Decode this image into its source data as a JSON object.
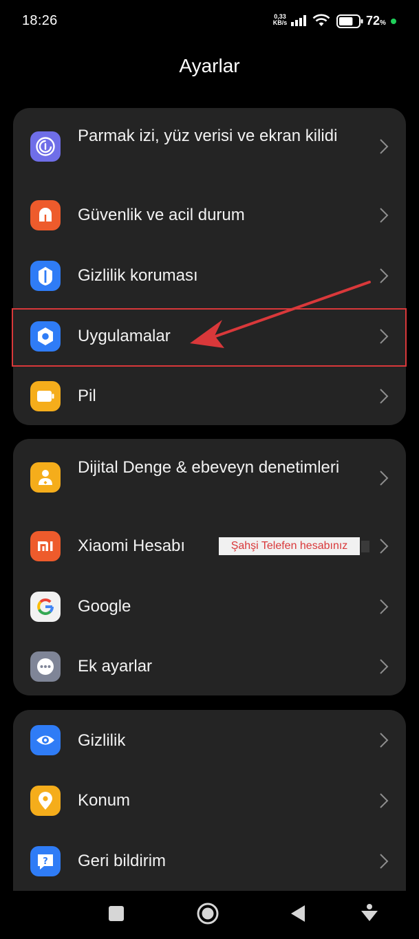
{
  "status_bar": {
    "time": "18:26",
    "net_speed_value": "0,33",
    "net_speed_unit": "KB/s",
    "battery_value": "72",
    "battery_unit": "%",
    "battery_level": 0.72,
    "charging_color": "#1fd05a"
  },
  "title": "Ayarlar",
  "groups": [
    {
      "items": [
        {
          "label": "Parmak izi, yüz verisi ve ekran kilidi",
          "icon": "fingerprint-icon",
          "color": "#6f6ee8"
        },
        {
          "label": "Güvenlik ve acil durum",
          "icon": "emergency-icon",
          "color": "#ee5b2c"
        },
        {
          "label": "Gizlilik koruması",
          "icon": "privacy-shield-icon",
          "color": "#2f7cf6"
        },
        {
          "label": "Uygulamalar",
          "icon": "apps-hexagon-icon",
          "color": "#2f7cf6"
        },
        {
          "label": "Pil",
          "icon": "battery-icon",
          "color": "#f5ad1b"
        }
      ]
    },
    {
      "items": [
        {
          "label": "Dijital Denge & ebeveyn denetimleri",
          "icon": "digital-wellbeing-icon",
          "color": "#f5ad1b"
        },
        {
          "label": "Xiaomi Hesabı",
          "icon": "xiaomi-mi-icon",
          "color": "#ee5b2c"
        },
        {
          "label": "Google",
          "icon": "google-g-icon",
          "color": "#f2f2f2"
        },
        {
          "label": "Ek ayarlar",
          "icon": "more-dots-icon",
          "color": "#7f8597"
        }
      ]
    },
    {
      "items": [
        {
          "label": "Gizlilik",
          "icon": "eye-icon",
          "color": "#2f7cf6"
        },
        {
          "label": "Konum",
          "icon": "location-pin-icon",
          "color": "#f5ad1b"
        },
        {
          "label": "Geri bildirim",
          "icon": "feedback-icon",
          "color": "#2f7cf6"
        }
      ]
    }
  ],
  "annotation": {
    "label": "Şahşi Telefen hesabınız",
    "color": "#d9383a"
  }
}
